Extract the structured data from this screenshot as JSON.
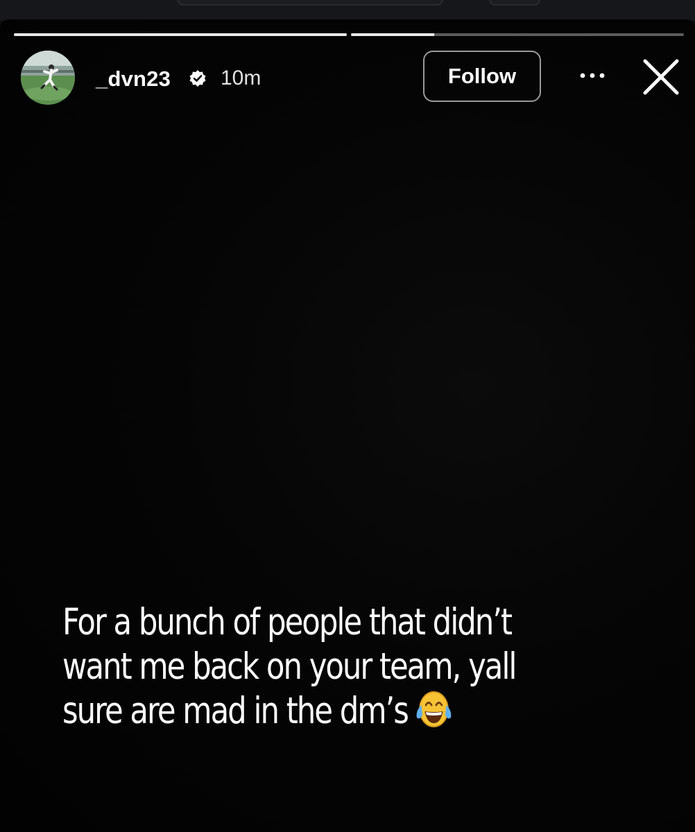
{
  "story": {
    "progress": [
      {
        "fraction": 1.0
      },
      {
        "fraction": 0.25
      }
    ]
  },
  "header": {
    "avatar_icon": "profile-photo-baseball-player",
    "username": "_dvn23",
    "verified_icon": "verified-badge-icon",
    "time": "10m",
    "follow_label": "Follow",
    "more_icon": "more-horizontal-icon",
    "close_icon": "close-icon"
  },
  "caption": {
    "lines": [
      "For a bunch of people that didn’t",
      "want me back on your team, yall",
      "sure are mad in the dm’s"
    ],
    "emoji": "face-with-tears-of-joy-icon"
  },
  "colors": {
    "background": "#000000",
    "text": "#ffffff",
    "follow_border": "#9a9a9a",
    "progress_active": "#e9e9e9"
  }
}
